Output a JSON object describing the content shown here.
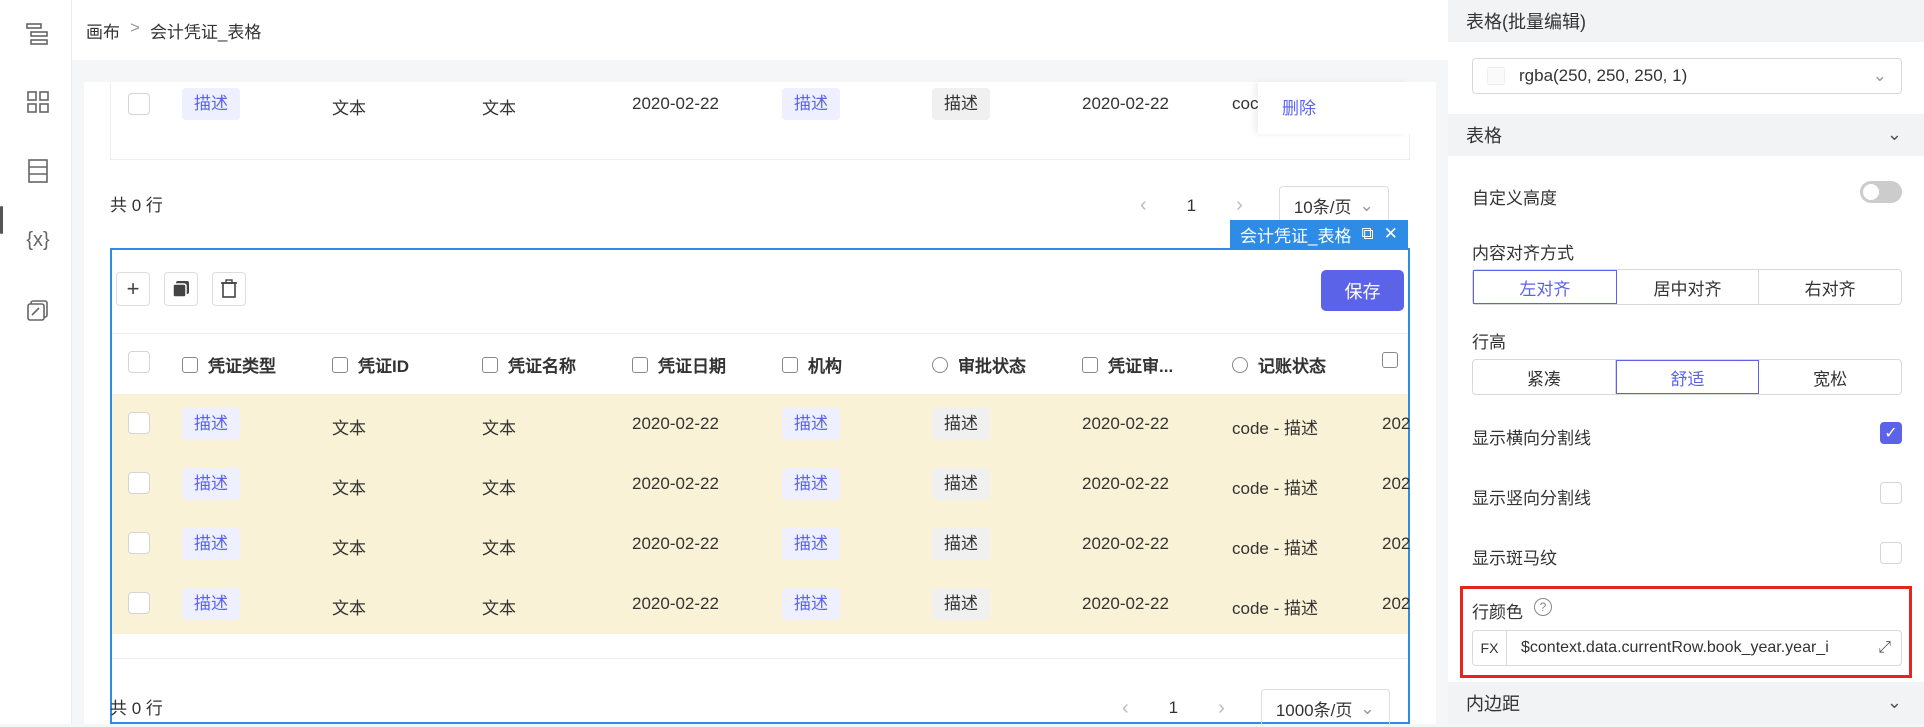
{
  "breadcrumb": {
    "root": "画布",
    "sep": ">",
    "current": "会计凭证_表格"
  },
  "left_icons": [
    "layers-icon",
    "grid-icon",
    "form-icon",
    "variable-icon",
    "edit-icon"
  ],
  "variable_label": "{x}",
  "top_table": {
    "row": {
      "c1": "描述",
      "c2": "文本",
      "c3": "文本",
      "c4": "2020-02-22",
      "c5": "描述",
      "c6": "描述",
      "c7": "2020-02-22",
      "c8": "coc",
      "action": "删除"
    },
    "total": "共 0 行",
    "page": "1",
    "page_size": "10条/页"
  },
  "selection": {
    "label": "会计凭证_表格"
  },
  "main_table": {
    "save": "保存",
    "headers": [
      "凭证类型",
      "凭证ID",
      "凭证名称",
      "凭证日期",
      "机构",
      "审批状态",
      "凭证审...",
      "记账状态"
    ],
    "rows": [
      {
        "c1": "描述",
        "c2": "文本",
        "c3": "文本",
        "c4": "2020-02-22",
        "c5": "描述",
        "c6": "描述",
        "c7": "2020-02-22",
        "c8": "code - 描述",
        "c9": "202"
      },
      {
        "c1": "描述",
        "c2": "文本",
        "c3": "文本",
        "c4": "2020-02-22",
        "c5": "描述",
        "c6": "描述",
        "c7": "2020-02-22",
        "c8": "code - 描述",
        "c9": "202"
      },
      {
        "c1": "描述",
        "c2": "文本",
        "c3": "文本",
        "c4": "2020-02-22",
        "c5": "描述",
        "c6": "描述",
        "c7": "2020-02-22",
        "c8": "code - 描述",
        "c9": "202"
      },
      {
        "c1": "描述",
        "c2": "文本",
        "c3": "文本",
        "c4": "2020-02-22",
        "c5": "描述",
        "c6": "描述",
        "c7": "2020-02-22",
        "c8": "code - 描述",
        "c9": "202"
      }
    ],
    "total": "共 0 行",
    "page": "1",
    "page_size": "1000条/页",
    "row_color": "#faf2d6"
  },
  "panel": {
    "section_batch": "表格(批量编辑)",
    "bg_color_value": "rgba(250, 250, 250, 1)",
    "section_table": "表格",
    "custom_height": "自定义高度",
    "align_label": "内容对齐方式",
    "align_options": [
      "左对齐",
      "居中对齐",
      "右对齐"
    ],
    "row_height_label": "行高",
    "row_height_options": [
      "紧凑",
      "舒适",
      "宽松"
    ],
    "show_h_divider": "显示横向分割线",
    "show_v_divider": "显示竖向分割线",
    "show_zebra": "显示斑马纹",
    "row_color_label": "行颜色",
    "fx": "FX",
    "row_color_expr": "$context.data.currentRow.book_year.year_i",
    "section_padding": "内边距",
    "accent": "#5b63e8",
    "highlight": "#e8241e"
  }
}
